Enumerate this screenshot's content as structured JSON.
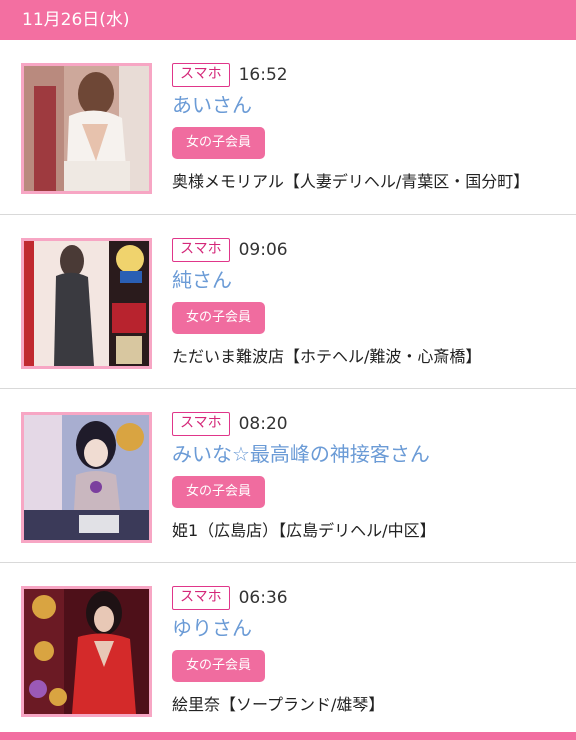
{
  "header": {
    "date": "11月26日(水)"
  },
  "entries": [
    {
      "device": "スマホ",
      "time": "16:52",
      "name": "あいさん",
      "member_badge": "女の子会員",
      "shop": "奥様メモリアル【人妻デリヘル/青葉区・国分町】",
      "thumb_colors": {
        "bg": "#c9a79a",
        "figure": "#f4efe9",
        "accent": "#8b5a48"
      }
    },
    {
      "device": "スマホ",
      "time": "09:06",
      "name": "純さん",
      "member_badge": "女の子会員",
      "shop": "ただいま難波店【ホテヘル/難波・心斎橋】",
      "thumb_colors": {
        "bg": "#f5e9e4",
        "figure": "#3a3a40",
        "accent": "#b8232e"
      }
    },
    {
      "device": "スマホ",
      "time": "08:20",
      "name": "みいな☆最高峰の神接客さん",
      "member_badge": "女の子会員",
      "shop": "姫1（広島店）【広島デリヘル/中区】",
      "thumb_colors": {
        "bg": "#9fa6c9",
        "figure": "#e9d6cf",
        "accent": "#7b3f9e"
      }
    },
    {
      "device": "スマホ",
      "time": "06:36",
      "name": "ゆりさん",
      "member_badge": "女の子会員",
      "shop": "絵里奈【ソープランド/雄琴】",
      "thumb_colors": {
        "bg": "#5a1420",
        "figure": "#d42a2a",
        "accent": "#d9a441"
      }
    }
  ],
  "colors": {
    "header_bg": "#f36fa1",
    "badge_pink": "#f06c9f",
    "name_blue": "#6b9bd6",
    "thumb_border": "#f7a6c4"
  }
}
